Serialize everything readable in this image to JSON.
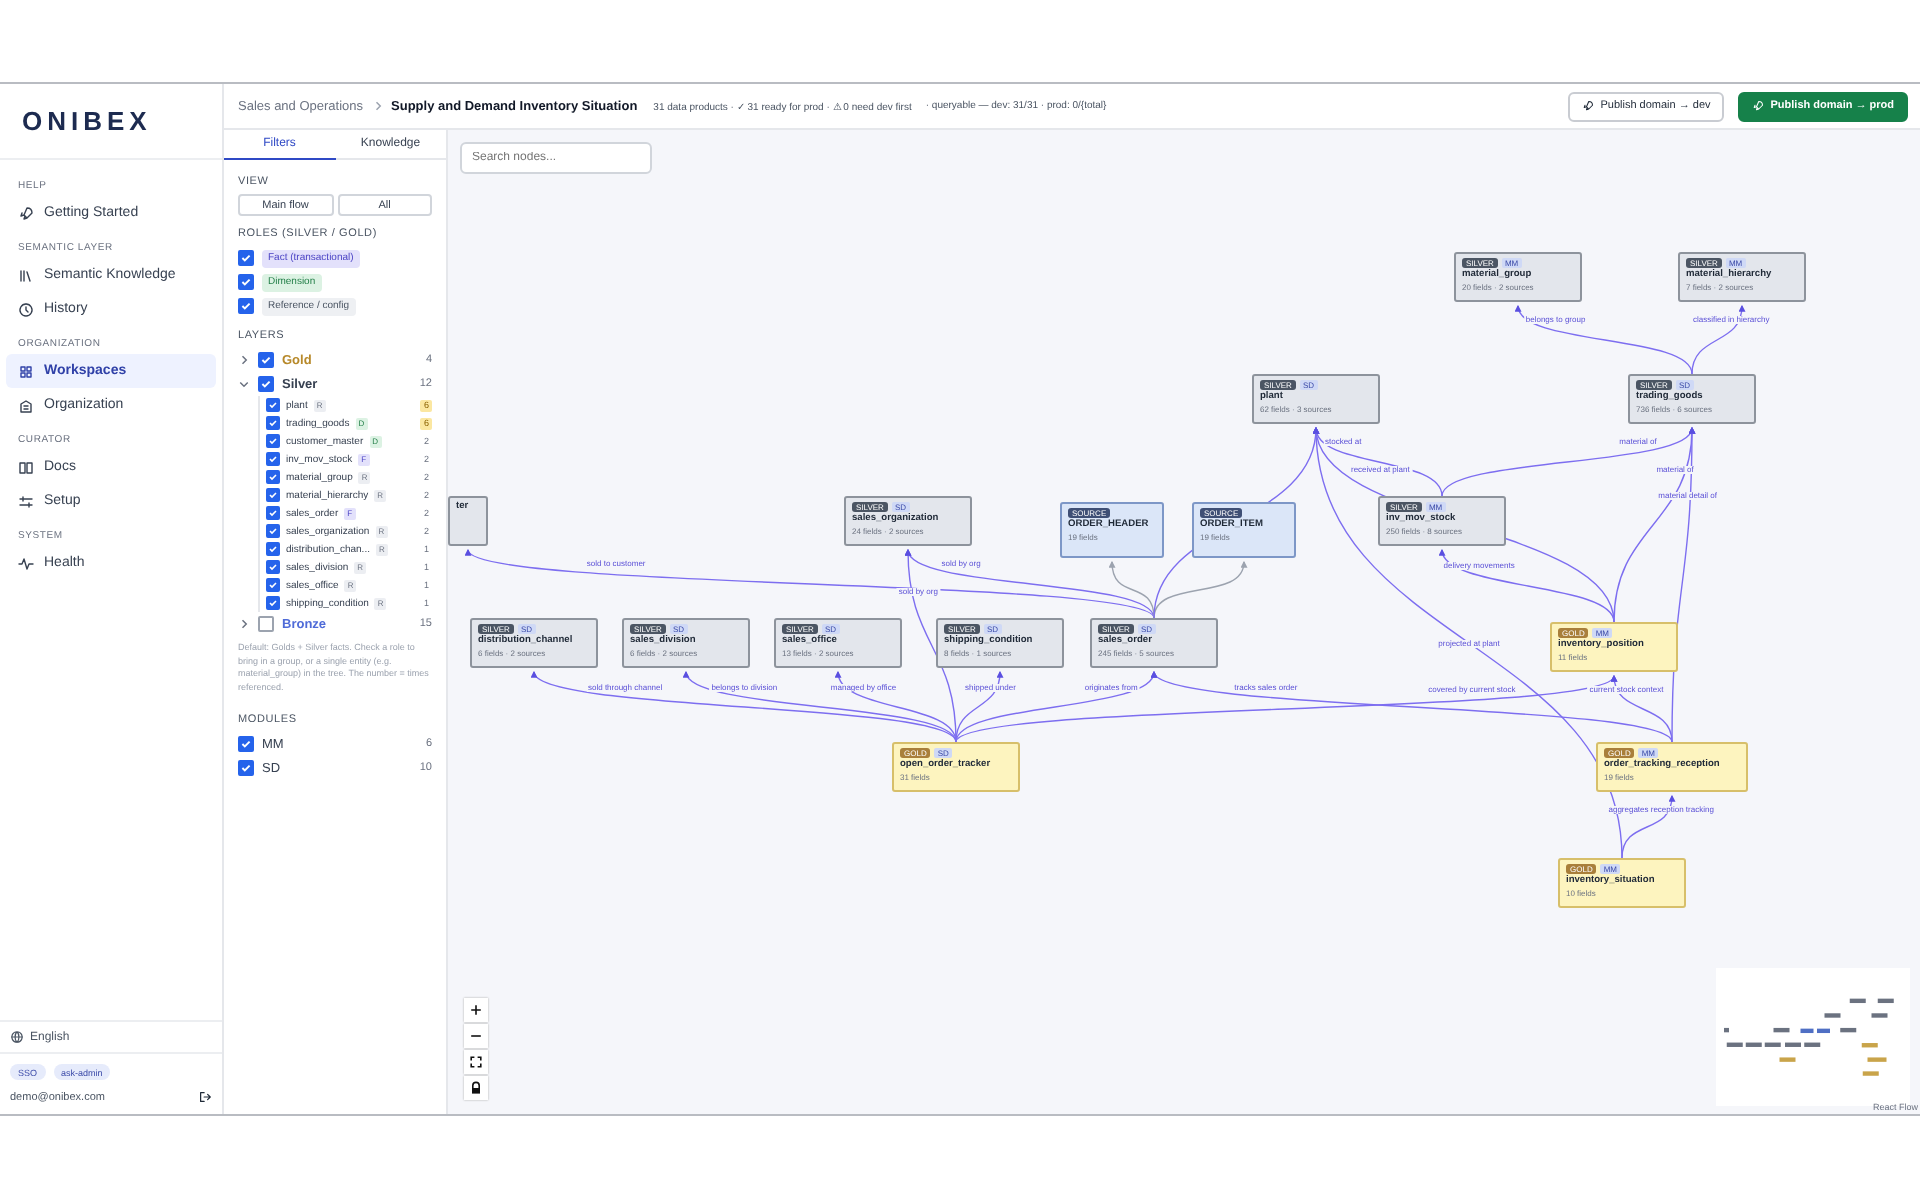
{
  "sidebar": {
    "logo": "ONIBEX",
    "sections": [
      {
        "heading": "HELP",
        "items": [
          {
            "label": "Getting Started",
            "selected": false
          }
        ]
      },
      {
        "heading": "SEMANTIC LAYER",
        "items": [
          {
            "label": "Semantic Knowledge",
            "selected": false
          },
          {
            "label": "History",
            "selected": false
          }
        ]
      },
      {
        "heading": "ORGANIZATION",
        "items": [
          {
            "label": "Workspaces",
            "selected": true
          },
          {
            "label": "Organization",
            "selected": false
          }
        ]
      },
      {
        "heading": "CURATOR",
        "items": [
          {
            "label": "Docs",
            "selected": false
          },
          {
            "label": "Setup",
            "selected": false
          }
        ]
      },
      {
        "heading": "SYSTEM",
        "items": [
          {
            "label": "Health",
            "selected": false
          }
        ]
      }
    ],
    "language": "English",
    "badges": [
      "SSO",
      "ask-admin"
    ],
    "user": "demo@onibex.com"
  },
  "header": {
    "breadcrumb": [
      "Sales and Operations",
      "Supply and Demand Inventory Situation"
    ],
    "stats": "31 data products · ✓ 31 ready for prod · ⚠ 0 need dev first",
    "queryable": "· queryable — dev: 31/31 · prod: 0/{total}",
    "buttons": [
      {
        "label": "Publish domain → dev",
        "kind": "secondary"
      },
      {
        "label": "Publish domain → prod",
        "kind": "primary"
      }
    ]
  },
  "filters": {
    "tabs": [
      {
        "label": "Filters",
        "selected": true
      },
      {
        "label": "Knowledge",
        "selected": false
      }
    ],
    "view": {
      "heading": "VIEW",
      "options": [
        {
          "label": "Main flow",
          "selected": false
        },
        {
          "label": "All",
          "selected": false
        }
      ]
    },
    "roles": {
      "heading": "ROLES (SILVER / GOLD)",
      "items": [
        {
          "label": "Fact (transactional)",
          "checked": true,
          "kind": "fact",
          "color": "#e3e1fb"
        },
        {
          "label": "Dimension",
          "checked": true,
          "kind": "dimension",
          "color": "#dcf2e3"
        },
        {
          "label": "Reference / config",
          "checked": true,
          "kind": "reference",
          "color": "#eef0f3"
        }
      ]
    },
    "layers": {
      "heading": "LAYERS",
      "items": [
        {
          "name": "Gold",
          "checked": true,
          "expanded": false,
          "count": "4",
          "color": "#b7892a"
        },
        {
          "name": "Silver",
          "checked": true,
          "expanded": true,
          "count": "12",
          "color": "#374151",
          "children": [
            {
              "name": "plant",
              "role": "R",
              "kind": "reference",
              "checked": true,
              "count": "6",
              "highlighted": true
            },
            {
              "name": "trading_goods",
              "role": "D",
              "kind": "dimension",
              "checked": true,
              "count": "6",
              "highlighted": true
            },
            {
              "name": "customer_master",
              "role": "D",
              "kind": "dimension",
              "checked": true,
              "count": "2",
              "highlighted": false
            },
            {
              "name": "inv_mov_stock",
              "role": "F",
              "kind": "fact",
              "checked": true,
              "count": "2",
              "highlighted": false
            },
            {
              "name": "material_group",
              "role": "R",
              "kind": "reference",
              "checked": true,
              "count": "2",
              "highlighted": false
            },
            {
              "name": "material_hierarchy",
              "role": "R",
              "kind": "reference",
              "checked": true,
              "count": "2",
              "highlighted": false
            },
            {
              "name": "sales_order",
              "role": "F",
              "kind": "fact",
              "checked": true,
              "count": "2",
              "highlighted": false
            },
            {
              "name": "sales_organization",
              "role": "R",
              "kind": "reference",
              "checked": true,
              "count": "2",
              "highlighted": false
            },
            {
              "name": "distribution_chan...",
              "role": "R",
              "kind": "reference",
              "checked": true,
              "count": "1",
              "highlighted": false
            },
            {
              "name": "sales_division",
              "role": "R",
              "kind": "reference",
              "checked": true,
              "count": "1",
              "highlighted": false
            },
            {
              "name": "sales_office",
              "role": "R",
              "kind": "reference",
              "checked": true,
              "count": "1",
              "highlighted": false
            },
            {
              "name": "shipping_condition",
              "role": "R",
              "kind": "reference",
              "checked": true,
              "count": "1",
              "highlighted": false
            }
          ]
        },
        {
          "name": "Bronze",
          "checked": false,
          "expanded": false,
          "count": "15",
          "color": "#4f6bd8"
        }
      ]
    },
    "note": "Default: Golds + Silver facts. Check a role to bring in a group, or a single entity (e.g. material_group) in the tree. The number = times referenced.",
    "modules": {
      "heading": "MODULES",
      "items": [
        {
          "label": "MM",
          "checked": true,
          "count": "6"
        },
        {
          "label": "SD",
          "checked": true,
          "count": "10"
        }
      ]
    }
  },
  "canvas": {
    "search": {
      "placeholder": "Search nodes..."
    },
    "nodes": [
      {
        "kind": "silver",
        "layer": "SILVER",
        "module": "MM",
        "name": "material_group",
        "detail": "20 fields · 2 sources"
      },
      {
        "kind": "silver",
        "layer": "SILVER",
        "module": "MM",
        "name": "material_hierarchy",
        "detail": "7 fields · 2 sources"
      },
      {
        "kind": "silver",
        "layer": "SILVER",
        "module": "SD",
        "name": "plant",
        "detail": "62 fields · 3 sources"
      },
      {
        "kind": "silver",
        "layer": "SILVER",
        "module": "SD",
        "name": "trading_goods",
        "detail": "736 fields · 6 sources"
      },
      {
        "kind": "silver",
        "name": "ter"
      },
      {
        "kind": "silver",
        "layer": "SILVER",
        "module": "SD",
        "name": "sales_organization",
        "detail": "24 fields · 2 sources"
      },
      {
        "kind": "source",
        "layer": "SOURCE",
        "name": "ORDER_HEADER",
        "detail": "19 fields"
      },
      {
        "kind": "source",
        "layer": "SOURCE",
        "name": "ORDER_ITEM",
        "detail": "19 fields"
      },
      {
        "kind": "silver",
        "layer": "SILVER",
        "module": "MM",
        "name": "inv_mov_stock",
        "detail": "250 fields · 8 sources"
      },
      {
        "kind": "silver",
        "layer": "SILVER",
        "module": "SD",
        "name": "distribution_channel",
        "detail": "6 fields · 2 sources"
      },
      {
        "kind": "silver",
        "layer": "SILVER",
        "module": "SD",
        "name": "sales_division",
        "detail": "6 fields · 2 sources"
      },
      {
        "kind": "silver",
        "layer": "SILVER",
        "module": "SD",
        "name": "sales_office",
        "detail": "13 fields · 2 sources"
      },
      {
        "kind": "silver",
        "layer": "SILVER",
        "module": "SD",
        "name": "shipping_condition",
        "detail": "8 fields · 1 sources"
      },
      {
        "kind": "silver",
        "layer": "SILVER",
        "module": "SD",
        "name": "sales_order",
        "detail": "245 fields · 5 sources"
      },
      {
        "kind": "gold",
        "layer": "GOLD",
        "module": "MM",
        "name": "inventory_position",
        "detail": "11 fields"
      },
      {
        "kind": "gold",
        "layer": "GOLD",
        "module": "SD",
        "name": "open_order_tracker",
        "detail": "31 fields"
      },
      {
        "kind": "gold",
        "layer": "GOLD",
        "module": "MM",
        "name": "order_tracking_reception",
        "detail": "19 fields"
      },
      {
        "kind": "gold",
        "layer": "GOLD",
        "module": "MM",
        "name": "inventory_situation",
        "detail": "10 fields"
      }
    ],
    "edges": [
      {
        "kind": "relation",
        "label": "belongs to group"
      },
      {
        "kind": "relation",
        "label": "classified in hierarchy"
      },
      {
        "kind": "relation",
        "label": "stocked at"
      },
      {
        "kind": "relation",
        "label": "material of"
      },
      {
        "kind": "relation",
        "label": "received at plant"
      },
      {
        "kind": "relation",
        "label": "material of"
      },
      {
        "kind": "relation",
        "label": "material detail of"
      },
      {
        "kind": "relation",
        "label": "sold to customer"
      },
      {
        "kind": "relation",
        "label": "sold by org"
      },
      {
        "kind": "relation",
        "label": "delivery movements"
      },
      {
        "kind": "relation",
        "label": "sold by org"
      },
      {
        "kind": "relation",
        "label": "projected at plant"
      },
      {
        "kind": "relation",
        "label": "sold through channel"
      },
      {
        "kind": "relation",
        "label": "belongs to division"
      },
      {
        "kind": "relation",
        "label": "managed by office"
      },
      {
        "kind": "relation",
        "label": "shipped under"
      },
      {
        "kind": "relation",
        "label": "originates from"
      },
      {
        "kind": "relation",
        "label": "tracks sales order"
      },
      {
        "kind": "relation",
        "label": "covered by current stock"
      },
      {
        "kind": "relation",
        "label": "current stock context"
      },
      {
        "kind": "relation",
        "label": "aggregates reception tracking"
      },
      {
        "kind": "lineage"
      },
      {
        "kind": "lineage"
      },
      {
        "kind": "relation"
      }
    ],
    "attribution": "React Flow"
  }
}
